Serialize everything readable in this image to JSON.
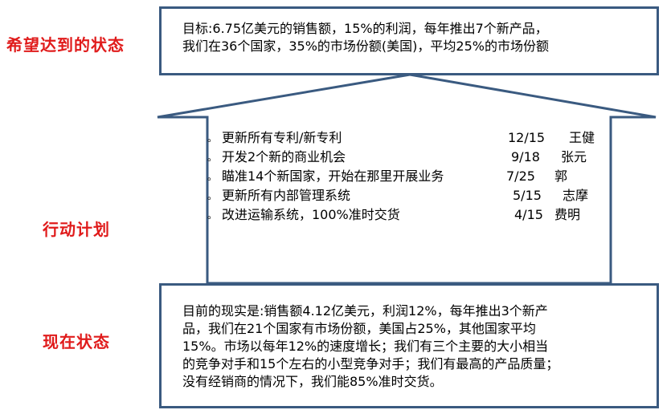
{
  "labels": {
    "goal": "希望达到的状态",
    "plan": "行动计划",
    "current": "现在状态"
  },
  "goal": {
    "lines": [
      "目标:6.75亿美元的销售额，15%的利润，每年推出7个新产品，",
      "我们在36个国家，35%的市场份额(美国)，平均25%的市场份额"
    ]
  },
  "plan": {
    "bullet": "。",
    "items": [
      {
        "task": "更新所有专利/新专利",
        "date": "12/15",
        "owner": "王健"
      },
      {
        "task": "开发2个新的商业机会",
        "date": "9/18",
        "owner": "张元"
      },
      {
        "task": "瞄准14个新国家，开始在那里开展业务",
        "date": "7/25",
        "owner": "郭"
      },
      {
        "task": "更新所有内部管理系统",
        "date": "5/15",
        "owner": "志摩"
      },
      {
        "task": "改进运输系统，100%准时交货",
        "date": "4/15",
        "owner": "费明"
      }
    ]
  },
  "current": {
    "lines": [
      "目前的现实是:销售额4.12亿美元，利润12%，每年推出3个新产",
      "品，我们在21个国家有市场份额，美国占25%，其他国家平均",
      "15%。市场以每年12%的速度增长；我们有三个主要的大小相当",
      "的竞争对手和15个左右的小型竞争对手；我们有最高的产品质量；",
      "没有经销商的情况下，我们能85%准时交货。"
    ]
  },
  "colors": {
    "label": "#e01b1b",
    "border": "#3a5a80"
  }
}
